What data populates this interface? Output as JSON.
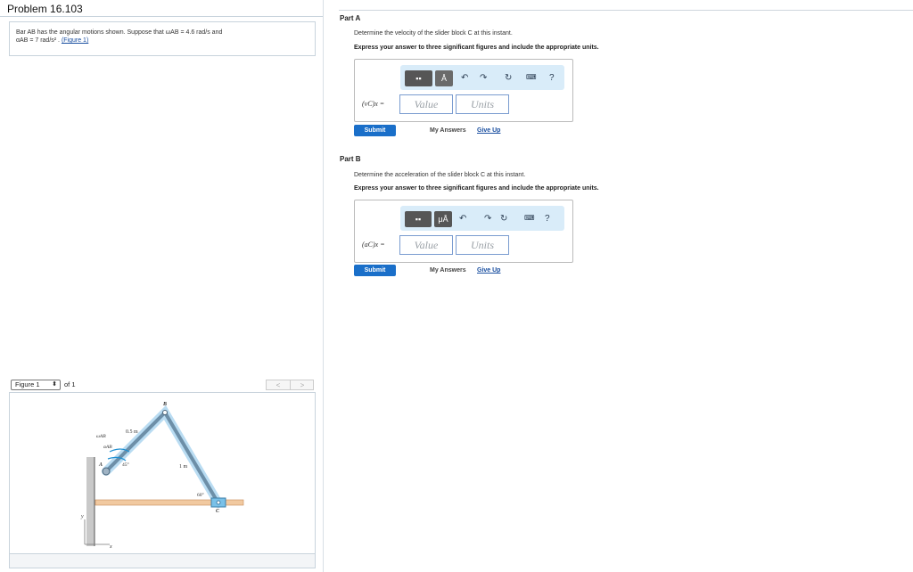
{
  "problem": {
    "title": "Problem 16.103",
    "text_line1": "Bar AB has the angular motions shown. Suppose that ωAB = 4.6 rad/s and",
    "text_line2": "αAB = 7 rad/s²  .",
    "figure_link": "(Figure 1)"
  },
  "figure": {
    "select_value": "Figure 1",
    "of_label": "of 1",
    "prev": "<",
    "next": ">",
    "labels": {
      "B": "B",
      "A": "A",
      "C": "C",
      "omega": "ωAB",
      "alpha": "αAB",
      "len_ab": "0.5 m",
      "len_bc": "1 m",
      "angle_a": "45°",
      "angle_c": "60°",
      "axis_y": "y",
      "axis_x": "x"
    }
  },
  "partA": {
    "label": "Part A",
    "question": "Determine the velocity of the slider block C at this instant.",
    "instructions": "Express your answer to three significant figures and include the appropriate units.",
    "answer_label": "(vC)x =",
    "value_placeholder": "Value",
    "units_placeholder": "Units",
    "submit": "Submit",
    "my_answers": "My Answers",
    "give_up": "Give Up",
    "help": "?"
  },
  "partB": {
    "label": "Part B",
    "question": "Determine the acceleration of the slider block C at this instant.",
    "instructions": "Express your answer to three significant figures and include the appropriate units.",
    "answer_label": "(aC)x =",
    "value_placeholder": "Value",
    "units_placeholder": "Units",
    "submit": "Submit",
    "my_answers": "My Answers",
    "give_up": "Give Up",
    "help": "?",
    "mu": "μÅ"
  }
}
